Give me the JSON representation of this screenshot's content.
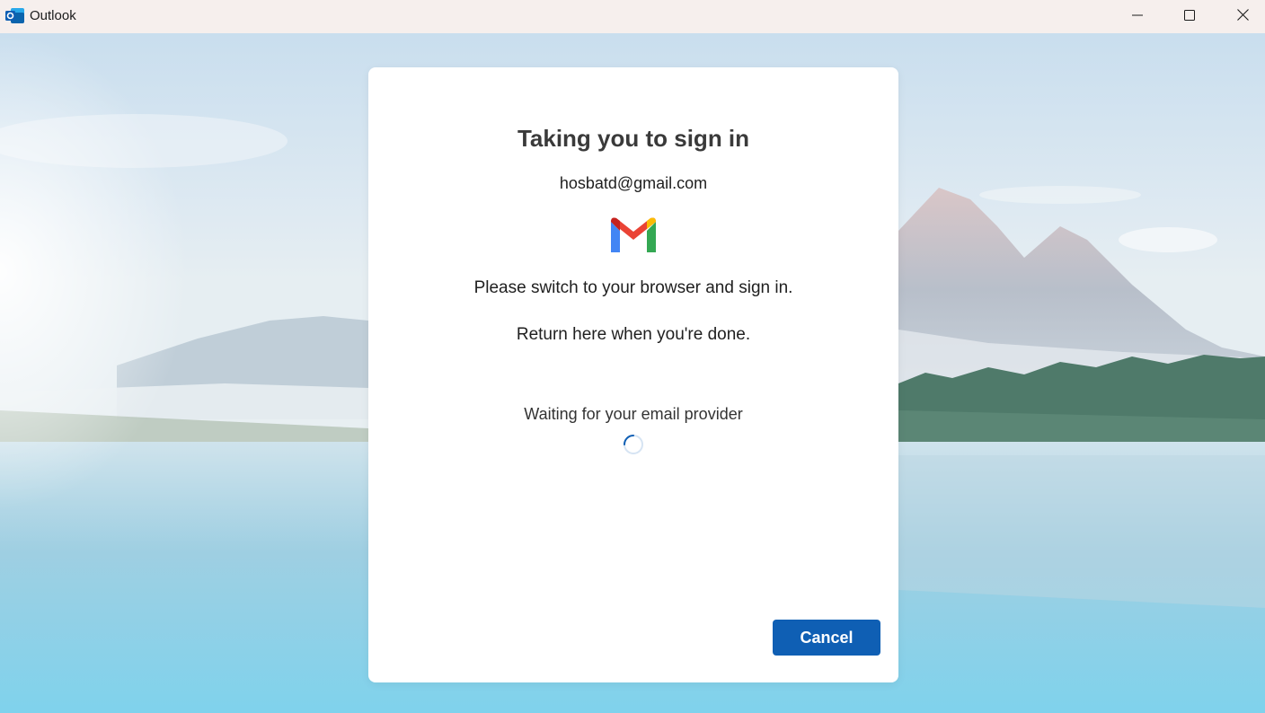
{
  "window": {
    "title": "Outlook",
    "app_icon": "outlook-icon",
    "controls": {
      "minimize_icon": "minimize-icon",
      "maximize_icon": "maximize-icon",
      "close_icon": "close-icon"
    }
  },
  "dialog": {
    "title": "Taking you to sign in",
    "email": "hosbatd@gmail.com",
    "provider_logo": "gmail-logo-icon",
    "instruction_1": "Please switch to your browser and sign in.",
    "instruction_2": "Return here when you're done.",
    "status": "Waiting for your email provider",
    "status_icon": "spinner-icon",
    "cancel_label": "Cancel"
  },
  "colors": {
    "accent": "#0f5fb4",
    "titlebar_bg": "#f6efed",
    "dialog_bg": "#ffffff"
  }
}
